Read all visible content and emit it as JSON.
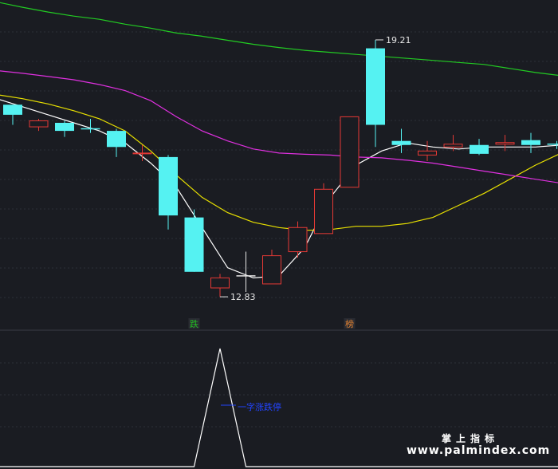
{
  "chart_data": {
    "type": "candlestick",
    "price_range": [
      12.0,
      20.2
    ],
    "candles": [
      {
        "open": 17.6,
        "close": 17.35,
        "high": 17.6,
        "low": 17.1,
        "color": "cyan"
      },
      {
        "open": 17.05,
        "close": 17.2,
        "high": 17.25,
        "low": 16.95,
        "color": "red"
      },
      {
        "open": 17.15,
        "close": 16.95,
        "high": 17.2,
        "low": 16.8,
        "color": "cyan"
      },
      {
        "open": 17.0,
        "close": 17.0,
        "high": 17.25,
        "low": 16.9,
        "color": "cyan"
      },
      {
        "open": 16.95,
        "close": 16.55,
        "high": 17.0,
        "low": 16.3,
        "color": "cyan"
      },
      {
        "open": 16.4,
        "close": 16.4,
        "high": 16.6,
        "low": 16.2,
        "color": "red"
      },
      {
        "open": 16.3,
        "close": 14.85,
        "high": 16.35,
        "low": 14.5,
        "color": "cyan"
      },
      {
        "open": 14.8,
        "close": 13.45,
        "high": 15.0,
        "low": 13.45,
        "color": "cyan"
      },
      {
        "open": 13.05,
        "close": 13.3,
        "high": 13.4,
        "low": 12.83,
        "color": "red"
      },
      {
        "open": 13.35,
        "close": 13.35,
        "high": 13.95,
        "low": 12.95,
        "color": "white"
      },
      {
        "open": 13.15,
        "close": 13.85,
        "high": 14.0,
        "low": 13.15,
        "color": "red"
      },
      {
        "open": 13.95,
        "close": 14.55,
        "high": 14.7,
        "low": 13.8,
        "color": "red"
      },
      {
        "open": 14.4,
        "close": 15.5,
        "high": 15.65,
        "low": 14.4,
        "color": "red"
      },
      {
        "open": 15.55,
        "close": 17.3,
        "high": 17.3,
        "low": 15.55,
        "color": "red"
      },
      {
        "open": 19.0,
        "close": 17.1,
        "high": 19.21,
        "low": 16.55,
        "color": "cyan"
      },
      {
        "open": 16.7,
        "close": 16.6,
        "high": 17.0,
        "low": 16.4,
        "color": "cyan"
      },
      {
        "open": 16.35,
        "close": 16.45,
        "high": 16.7,
        "low": 16.2,
        "color": "red"
      },
      {
        "open": 16.55,
        "close": 16.62,
        "high": 16.85,
        "low": 16.45,
        "color": "red"
      },
      {
        "open": 16.6,
        "close": 16.38,
        "high": 16.75,
        "low": 16.35,
        "color": "cyan"
      },
      {
        "open": 16.62,
        "close": 16.66,
        "high": 16.85,
        "low": 16.45,
        "color": "red"
      },
      {
        "open": 16.72,
        "close": 16.6,
        "high": 16.9,
        "low": 16.4,
        "color": "cyan"
      },
      {
        "open": 16.62,
        "close": 16.62,
        "high": 16.7,
        "low": 16.5,
        "color": "cyan"
      }
    ],
    "moving_averages": [
      {
        "color": "#ffffff",
        "values": [
          17.75,
          17.55,
          17.35,
          17.15,
          16.95,
          16.65,
          16.15,
          15.55,
          14.55,
          13.55,
          13.3,
          13.35,
          14.05,
          15.3,
          16.1,
          16.45,
          16.65,
          16.55,
          16.5,
          16.55,
          16.55,
          16.55,
          16.6
        ]
      },
      {
        "color": "#e8e000",
        "values": [
          17.85,
          17.75,
          17.62,
          17.45,
          17.25,
          16.95,
          16.45,
          15.85,
          15.3,
          14.92,
          14.68,
          14.55,
          14.48,
          14.5,
          14.58,
          14.58,
          14.65,
          14.8,
          15.1,
          15.4,
          15.75,
          16.1,
          16.4
        ]
      },
      {
        "color": "#e030e0",
        "values": [
          18.45,
          18.38,
          18.3,
          18.22,
          18.1,
          17.95,
          17.7,
          17.3,
          16.95,
          16.7,
          16.5,
          16.4,
          16.37,
          16.35,
          16.3,
          16.28,
          16.22,
          16.15,
          16.05,
          15.95,
          15.85,
          15.75,
          15.65
        ]
      },
      {
        "color": "#22cc22",
        "values": [
          20.15,
          20.02,
          19.9,
          19.8,
          19.72,
          19.6,
          19.5,
          19.38,
          19.3,
          19.2,
          19.1,
          19.02,
          18.95,
          18.9,
          18.85,
          18.8,
          18.75,
          18.7,
          18.65,
          18.6,
          18.5,
          18.4,
          18.32
        ]
      }
    ],
    "annotations": [
      {
        "text": "19.21",
        "candle_index": 14,
        "anchor": "high"
      },
      {
        "text": "12.83",
        "candle_index": 8,
        "anchor": "low"
      }
    ],
    "signals": [
      {
        "text": "跌",
        "candle_index": 7,
        "color": "#22bb22"
      },
      {
        "text": "榜",
        "candle_index": 13,
        "color": "#e08030"
      }
    ],
    "indicator": {
      "type": "line",
      "values": [
        0,
        0,
        0,
        0,
        0,
        0,
        0,
        0,
        1,
        0,
        0,
        0,
        0,
        0,
        0,
        0,
        0,
        0,
        0,
        0,
        0,
        0
      ],
      "label": "一字涨跌停"
    }
  },
  "colors": {
    "background": "#1a1c22",
    "up": "#e53935",
    "down": "#55f2f2",
    "doji": "#e6e6e6",
    "indicator": "#ffffff"
  },
  "watermark": {
    "line1": "掌上指标",
    "line2": "www.palmindex.com"
  }
}
